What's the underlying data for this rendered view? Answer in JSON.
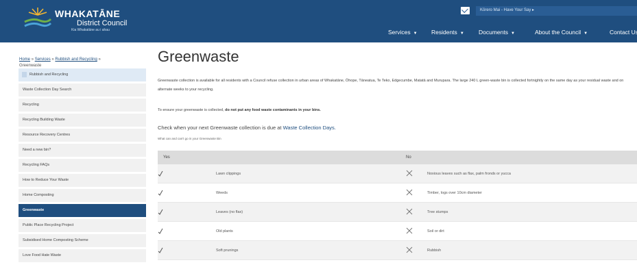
{
  "header": {
    "logo_title": "WHAKATĀNE",
    "logo_subtitle": "District Council",
    "logo_tagline": "Kia Whakatāne au i ahau",
    "banner_text": "Kōrero Mai - Have Your Say ▸",
    "banner_icon": "envelope-icon",
    "nav": [
      {
        "label": "Services"
      },
      {
        "label": "Residents"
      },
      {
        "label": "Documents"
      },
      {
        "label": "About the Council"
      },
      {
        "label": "Contact Us"
      }
    ]
  },
  "breadcrumb": {
    "home": "Home",
    "services": "Services",
    "rubbish": "Rubbish and Recycling",
    "current": "Greenwaste",
    "separator": "»"
  },
  "sidebar": {
    "items": [
      {
        "label": "Rubbish and Recycling"
      },
      {
        "label": "Waste Collection Day Search"
      },
      {
        "label": "Recycling"
      },
      {
        "label": "Recycling Building Waste"
      },
      {
        "label": "Resource Recovery Centres"
      },
      {
        "label": "Need a new bin?"
      },
      {
        "label": "Recycling FAQs"
      },
      {
        "label": "How to Reduce Your Waste"
      },
      {
        "label": "Home Composting"
      },
      {
        "label": "Greenwaste"
      },
      {
        "label": "Public Place Recycling Project"
      },
      {
        "label": "Subsidised Home Composting Scheme"
      },
      {
        "label": "Love Food Hate Waste"
      }
    ]
  },
  "main": {
    "title": "Greenwaste",
    "intro": "Greenwaste collection is available for all residents with a Council refuse collection in urban areas of Whakatāne, Ōhope, Tāneatua, Te Teko, Edgecumbe, Matatā and Murupara. The large 240 L green-waste bin is collected fortnightly on the same day as your residual waste and on alternate weeks to your recycling.",
    "ensure_prefix": "To ensure your greenwaste is collected, ",
    "ensure_bold": "do not put any food waste contaminants in your bins.",
    "check_prefix": "Check when your next Greenwaste collection is due at ",
    "check_link": "Waste Collection Days.",
    "small_note": "What can and can't go in your Greenwaste Bin",
    "table": {
      "header_yes": "Yes",
      "header_no": "No",
      "rows": [
        {
          "yes": "Lawn clippings",
          "no": "Noxious leaves such as flax, palm fronds or yucca"
        },
        {
          "yes": "Weeds",
          "no": "Timber, logs over 10cm diameter"
        },
        {
          "yes": "Leaves (no flax)",
          "no": "Tree stumps"
        },
        {
          "yes": "Old plants",
          "no": "Soil or dirt"
        },
        {
          "yes": "Soft prunings",
          "no": "Rubbish"
        }
      ]
    }
  },
  "colors": {
    "header_bg": "#1f4e7f",
    "active_item": "#1f4e7f",
    "parent_item": "#dfeaf5"
  }
}
